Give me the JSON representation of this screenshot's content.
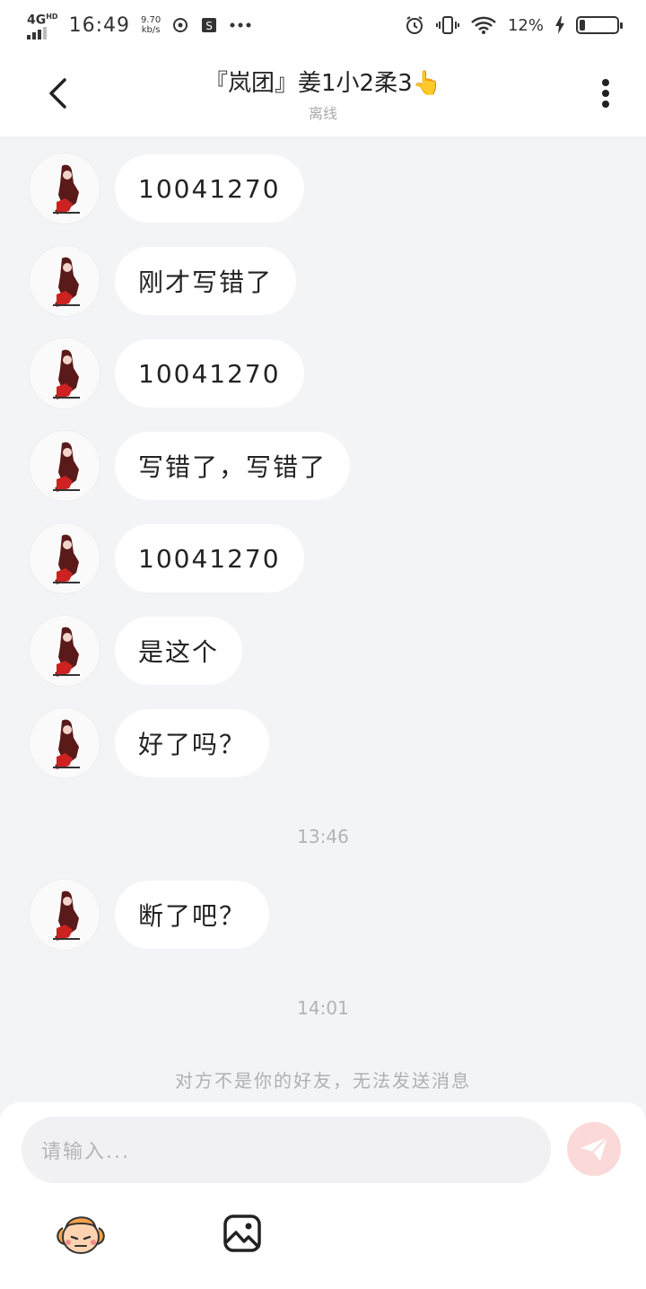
{
  "status_bar": {
    "network": "4G",
    "network_sub": "HD",
    "time": "16:49",
    "speed_value": "9.70",
    "speed_unit": "kb/s",
    "battery_percent": "12%",
    "battery_level": 0.12,
    "icons": [
      "signal-icon",
      "vpn-icon",
      "sim-icon",
      "more-dots-icon",
      "alarm-icon",
      "vibrate-icon",
      "wifi-icon",
      "charging-icon",
      "battery-icon"
    ]
  },
  "header": {
    "title": "『岚团』姜1小2柔3",
    "title_emoji": "👆",
    "status": "离线"
  },
  "messages": [
    {
      "text": "10041270"
    },
    {
      "text": "刚才写错了"
    },
    {
      "text": "10041270"
    },
    {
      "text": "写错了，写错了"
    },
    {
      "text": "10041270"
    },
    {
      "text": "是这个"
    },
    {
      "text": "好了吗？"
    },
    {
      "text": "断了吧？"
    }
  ],
  "timestamps": [
    "13:46",
    "14:01"
  ],
  "notice": "对方不是你的好友，无法发送消息",
  "composer": {
    "placeholder": "请输入..."
  },
  "colors": {
    "background": "#f3f4f6",
    "bubble": "#ffffff",
    "send_disabled": "#fbd9d9",
    "send_icon": "#ffffff"
  }
}
